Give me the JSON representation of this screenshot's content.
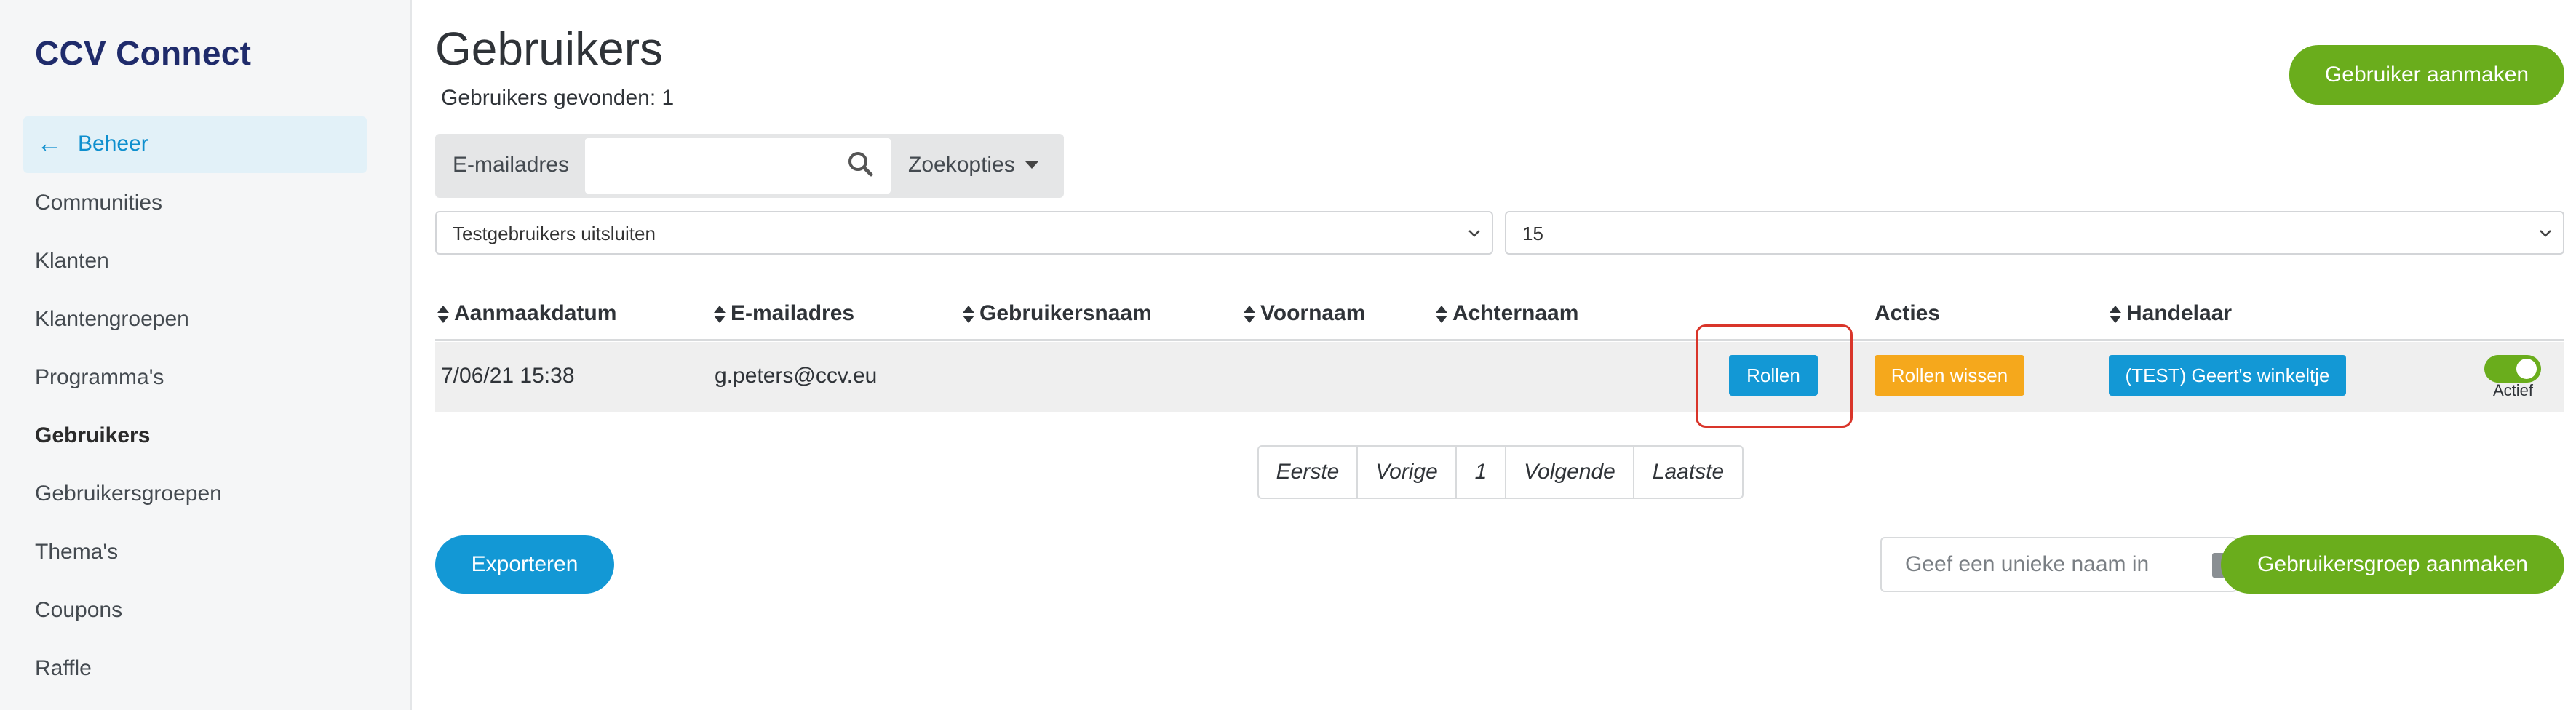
{
  "app": {
    "brand": "CCV Connect"
  },
  "sidebar": {
    "back_label": "Beheer",
    "items": [
      {
        "label": "Communities"
      },
      {
        "label": "Klanten"
      },
      {
        "label": "Klantengroepen"
      },
      {
        "label": "Programma's"
      },
      {
        "label": "Gebruikers",
        "active": true
      },
      {
        "label": "Gebruikersgroepen"
      },
      {
        "label": "Thema's"
      },
      {
        "label": "Coupons"
      },
      {
        "label": "Raffle"
      }
    ]
  },
  "page": {
    "title": "Gebruikers",
    "subtitle": "Gebruikers gevonden: 1",
    "create_button": "Gebruiker aanmaken"
  },
  "search": {
    "label": "E-mailadres",
    "value": "",
    "options_label": "Zoekopties"
  },
  "filters": {
    "test_users": "Testgebruikers uitsluiten",
    "page_size": "15"
  },
  "table": {
    "columns": [
      "Aanmaakdatum",
      "E-mailadres",
      "Gebruikersnaam",
      "Voornaam",
      "Achternaam",
      "Acties",
      "Handelaar"
    ],
    "rows": [
      {
        "created": "7/06/21 15:38",
        "email": "g.peters@ccv.eu",
        "username": "",
        "firstname": "",
        "lastname": "",
        "roles_button": "Rollen",
        "clear_roles_button": "Rollen wissen",
        "merchant_button": "(TEST) Geert's winkeltje",
        "status_label": "Actief",
        "status_on": true
      }
    ]
  },
  "pagination": {
    "first": "Eerste",
    "prev": "Vorige",
    "current": "1",
    "next": "Volgende",
    "last": "Laatste"
  },
  "footer": {
    "export_button": "Exporteren",
    "group_name_placeholder": "Geef een unieke naam in",
    "create_group_button": "Gebruikersgroep aanmaken"
  },
  "colors": {
    "brand": "#1f2b6b",
    "primary_blue": "#1398d5",
    "green": "#6aad1c",
    "orange": "#f5a81c",
    "highlight_red": "#d9352a"
  },
  "icons": {
    "back": "arrow-left-icon",
    "search": "search-icon",
    "dropdown": "caret-down-icon",
    "sort": "sort-icon",
    "select": "chevron-down-icon"
  }
}
